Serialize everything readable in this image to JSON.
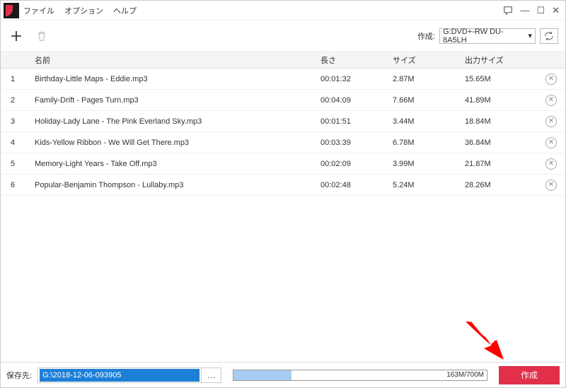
{
  "menu": {
    "file": "ファイル",
    "option": "オプション",
    "help": "ヘルプ"
  },
  "toolbar": {
    "create_label": "作成:",
    "device": "G:DVD+-RW DU-8A5LH"
  },
  "columns": {
    "name": "名前",
    "length": "長さ",
    "size": "サイズ",
    "output": "出力サイズ"
  },
  "rows": [
    {
      "idx": "1",
      "name": "Birthday-Little Maps - Eddie.mp3",
      "len": "00:01:32",
      "size": "2.87M",
      "out": "15.65M"
    },
    {
      "idx": "2",
      "name": "Family-Drift - Pages Turn.mp3",
      "len": "00:04:09",
      "size": "7.66M",
      "out": "41.89M"
    },
    {
      "idx": "3",
      "name": "Holiday-Lady Lane - The Pink Everland Sky.mp3",
      "len": "00:01:51",
      "size": "3.44M",
      "out": "18.84M"
    },
    {
      "idx": "4",
      "name": "Kids-Yellow Ribbon - We Will Get There.mp3",
      "len": "00:03:39",
      "size": "6.78M",
      "out": "36.84M"
    },
    {
      "idx": "5",
      "name": "Memory-Light Years - Take Off.mp3",
      "len": "00:02:09",
      "size": "3.99M",
      "out": "21.87M"
    },
    {
      "idx": "6",
      "name": "Popular-Benjamin Thompson - Lullaby.mp3",
      "len": "00:02:48",
      "size": "5.24M",
      "out": "28.26M"
    }
  ],
  "footer": {
    "save_label": "保存先:",
    "path": "G:\\2018-12-06-093905",
    "progress_text": "163M/700M",
    "create_button": "作成"
  }
}
